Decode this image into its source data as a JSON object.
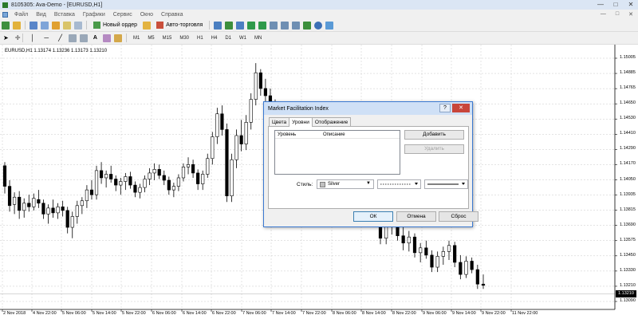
{
  "window": {
    "title": "8105305: Ava-Demo - [EURUSD,H1]",
    "controls": [
      "—",
      "□",
      "✕"
    ]
  },
  "menu": {
    "items": [
      "Файл",
      "Вид",
      "Вставка",
      "Графики",
      "Сервис",
      "Окно",
      "Справка"
    ],
    "mdi_controls": [
      "—",
      "□",
      "✕"
    ]
  },
  "toolbar": {
    "new_order_label": "Новый ордер",
    "auto_trading_label": "Авто-торговля",
    "timeframes": [
      "M1",
      "M5",
      "M15",
      "M30",
      "H1",
      "H4",
      "D1",
      "W1",
      "MN"
    ]
  },
  "chart": {
    "symbol_info": "EURUSD,H1  1.13174 1.13236 1.13173 1.13210",
    "current_price": "1.13210"
  },
  "chart_data": {
    "type": "candlestick",
    "y_ticks": [
      "1.15005",
      "1.14885",
      "1.14765",
      "1.14650",
      "1.14530",
      "1.14410",
      "1.14290",
      "1.14170",
      "1.14050",
      "1.13935",
      "1.13815",
      "1.13690",
      "1.13575",
      "1.13450",
      "1.13330",
      "1.13210",
      "1.13090"
    ],
    "x_ticks": [
      "2 Nov 2018",
      "4 Nov 22:00",
      "5 Nov 06:00",
      "5 Nov 14:00",
      "5 Nov 22:00",
      "6 Nov 06:00",
      "6 Nov 14:00",
      "6 Nov 22:00",
      "7 Nov 06:00",
      "7 Nov 14:00",
      "7 Nov 22:00",
      "8 Nov 06:00",
      "8 Nov 14:00",
      "8 Nov 22:00",
      "9 Nov 06:00",
      "9 Nov 14:00",
      "9 Nov 22:00",
      "11 Nov 22:00"
    ],
    "ylim": [
      1.1303,
      1.1515
    ],
    "candles": [
      [
        1.142,
        1.1423,
        1.1397,
        1.1403
      ],
      [
        1.1403,
        1.1408,
        1.1382,
        1.1387
      ],
      [
        1.1388,
        1.1398,
        1.138,
        1.1394
      ],
      [
        1.1394,
        1.1399,
        1.1376,
        1.1383
      ],
      [
        1.1383,
        1.1393,
        1.1377,
        1.1389
      ],
      [
        1.1389,
        1.1396,
        1.1382,
        1.1386
      ],
      [
        1.1386,
        1.1397,
        1.1383,
        1.1393
      ],
      [
        1.1392,
        1.14,
        1.1385,
        1.1389
      ],
      [
        1.1389,
        1.1392,
        1.1376,
        1.138
      ],
      [
        1.138,
        1.1388,
        1.1372,
        1.1385
      ],
      [
        1.1385,
        1.1392,
        1.1377,
        1.1381
      ],
      [
        1.1381,
        1.1389,
        1.1376,
        1.1386
      ],
      [
        1.1386,
        1.1391,
        1.1378,
        1.1383
      ],
      [
        1.1383,
        1.1386,
        1.1364,
        1.1369
      ],
      [
        1.1369,
        1.1382,
        1.136,
        1.1378
      ],
      [
        1.1378,
        1.1391,
        1.1372,
        1.1387
      ],
      [
        1.1387,
        1.1394,
        1.138,
        1.1391
      ],
      [
        1.1391,
        1.1404,
        1.1385,
        1.14
      ],
      [
        1.14,
        1.1408,
        1.1392,
        1.1396
      ],
      [
        1.1396,
        1.142,
        1.1392,
        1.1416
      ],
      [
        1.1416,
        1.1423,
        1.1405,
        1.141
      ],
      [
        1.141,
        1.1416,
        1.1402,
        1.1413
      ],
      [
        1.1413,
        1.142,
        1.1406,
        1.1409
      ],
      [
        1.1409,
        1.1412,
        1.1399,
        1.1404
      ],
      [
        1.1404,
        1.141,
        1.1396,
        1.1407
      ],
      [
        1.1407,
        1.1414,
        1.14,
        1.1411
      ],
      [
        1.1411,
        1.1415,
        1.1401,
        1.1404
      ],
      [
        1.1404,
        1.1407,
        1.1394,
        1.1398
      ],
      [
        1.1398,
        1.1405,
        1.1393,
        1.1402
      ],
      [
        1.1402,
        1.1412,
        1.1398,
        1.1409
      ],
      [
        1.1409,
        1.1418,
        1.1404,
        1.1414
      ],
      [
        1.1414,
        1.1422,
        1.1408,
        1.1417
      ],
      [
        1.1417,
        1.1421,
        1.1409,
        1.1412
      ],
      [
        1.1412,
        1.1416,
        1.1404,
        1.1408
      ],
      [
        1.1408,
        1.1411,
        1.1396,
        1.14
      ],
      [
        1.14,
        1.1406,
        1.1394,
        1.1403
      ],
      [
        1.1403,
        1.1413,
        1.1399,
        1.141
      ],
      [
        1.141,
        1.1422,
        1.1407,
        1.1419
      ],
      [
        1.1419,
        1.1427,
        1.1413,
        1.1421
      ],
      [
        1.1421,
        1.1425,
        1.141,
        1.1414
      ],
      [
        1.1414,
        1.1417,
        1.14,
        1.1405
      ],
      [
        1.1405,
        1.1416,
        1.14,
        1.1413
      ],
      [
        1.1413,
        1.143,
        1.141,
        1.1426
      ],
      [
        1.1426,
        1.1448,
        1.1421,
        1.1444
      ],
      [
        1.1444,
        1.1468,
        1.1438,
        1.1463
      ],
      [
        1.1463,
        1.147,
        1.1445,
        1.145
      ],
      [
        1.145,
        1.1455,
        1.139,
        1.1395
      ],
      [
        1.1395,
        1.143,
        1.139,
        1.1425
      ],
      [
        1.1425,
        1.145,
        1.1418,
        1.1445
      ],
      [
        1.1445,
        1.1458,
        1.1432,
        1.1438
      ],
      [
        1.1438,
        1.1462,
        1.1433,
        1.1456
      ],
      [
        1.1456,
        1.148,
        1.145,
        1.1475
      ],
      [
        1.1475,
        1.1505,
        1.147,
        1.1497
      ],
      [
        1.1497,
        1.15,
        1.1478,
        1.1484
      ],
      [
        1.1484,
        1.1492,
        1.1471,
        1.1478
      ],
      [
        1.1478,
        1.1484,
        1.1465,
        1.147
      ],
      [
        1.147,
        1.1475,
        1.146,
        1.1465
      ],
      [
        1.1375,
        1.138,
        1.1355,
        1.136
      ],
      [
        1.136,
        1.1376,
        1.1355,
        1.1372
      ],
      [
        1.1372,
        1.1378,
        1.1363,
        1.137
      ],
      [
        1.137,
        1.1375,
        1.1358,
        1.1362
      ],
      [
        1.1362,
        1.137,
        1.135,
        1.1356
      ],
      [
        1.1356,
        1.1366,
        1.1349,
        1.1361
      ],
      [
        1.1361,
        1.1364,
        1.1344,
        1.1348
      ],
      [
        1.1348,
        1.1356,
        1.134,
        1.1352
      ],
      [
        1.1352,
        1.1358,
        1.1343,
        1.1346
      ],
      [
        1.1346,
        1.135,
        1.1332,
        1.1336
      ],
      [
        1.1336,
        1.1349,
        1.1332,
        1.1345
      ],
      [
        1.1345,
        1.1353,
        1.1338,
        1.1349
      ],
      [
        1.1349,
        1.1358,
        1.1342,
        1.1354
      ],
      [
        1.1354,
        1.1357,
        1.1336,
        1.134
      ],
      [
        1.134,
        1.1346,
        1.1326,
        1.133
      ],
      [
        1.133,
        1.1345,
        1.1327,
        1.1341
      ],
      [
        1.1341,
        1.1344,
        1.1331,
        1.1334
      ],
      [
        1.1334,
        1.1338,
        1.1318,
        1.1322
      ],
      [
        1.1322,
        1.133,
        1.1318,
        1.1321
      ]
    ]
  },
  "dialog": {
    "title": "Market Facilitation Index",
    "help_label": "?",
    "close_label": "✕",
    "tabs": [
      "Цвета",
      "Уровни",
      "Отображение"
    ],
    "list_headers": [
      "Уровень",
      "Описание"
    ],
    "add_label": "Добавить",
    "delete_label": "Удалить",
    "style_label": "Стиль:",
    "color_value": "Silver",
    "ok_label": "ОК",
    "cancel_label": "Отмена",
    "reset_label": "Сброс"
  }
}
